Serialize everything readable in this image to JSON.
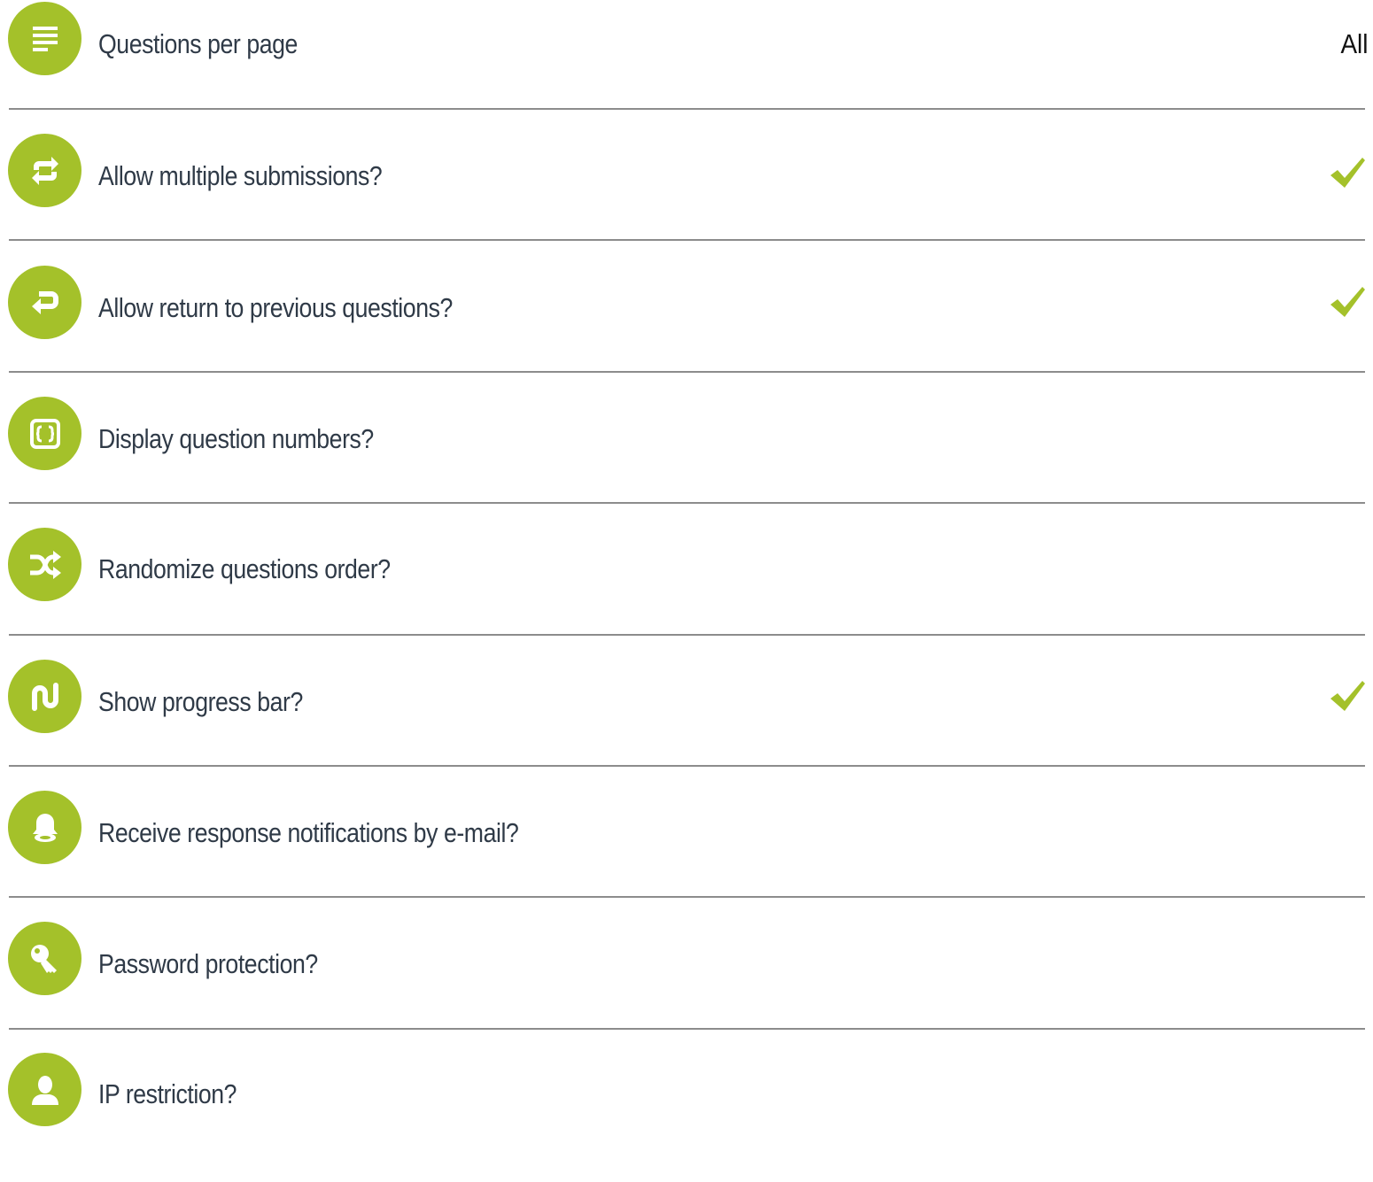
{
  "settings": {
    "accent_color": "#a4c12a",
    "items": [
      {
        "label": "Questions per page",
        "icon": "lines-icon",
        "value": "All",
        "checked": false
      },
      {
        "label": "Allow multiple submissions?",
        "icon": "repeat-icon",
        "value": "",
        "checked": true
      },
      {
        "label": "Allow return to previous questions?",
        "icon": "return-arrow-icon",
        "value": "",
        "checked": true
      },
      {
        "label": "Display question numbers?",
        "icon": "numbering-icon",
        "value": "",
        "checked": false
      },
      {
        "label": "Randomize questions order?",
        "icon": "shuffle-icon",
        "value": "",
        "checked": false
      },
      {
        "label": "Show progress bar?",
        "icon": "progress-path-icon",
        "value": "",
        "checked": true
      },
      {
        "label": "Receive response notifications by e-mail?",
        "icon": "bell-icon",
        "value": "",
        "checked": false
      },
      {
        "label": "Password protection?",
        "icon": "key-icon",
        "value": "",
        "checked": false
      },
      {
        "label": "IP restriction?",
        "icon": "user-icon",
        "value": "",
        "checked": false
      }
    ]
  }
}
